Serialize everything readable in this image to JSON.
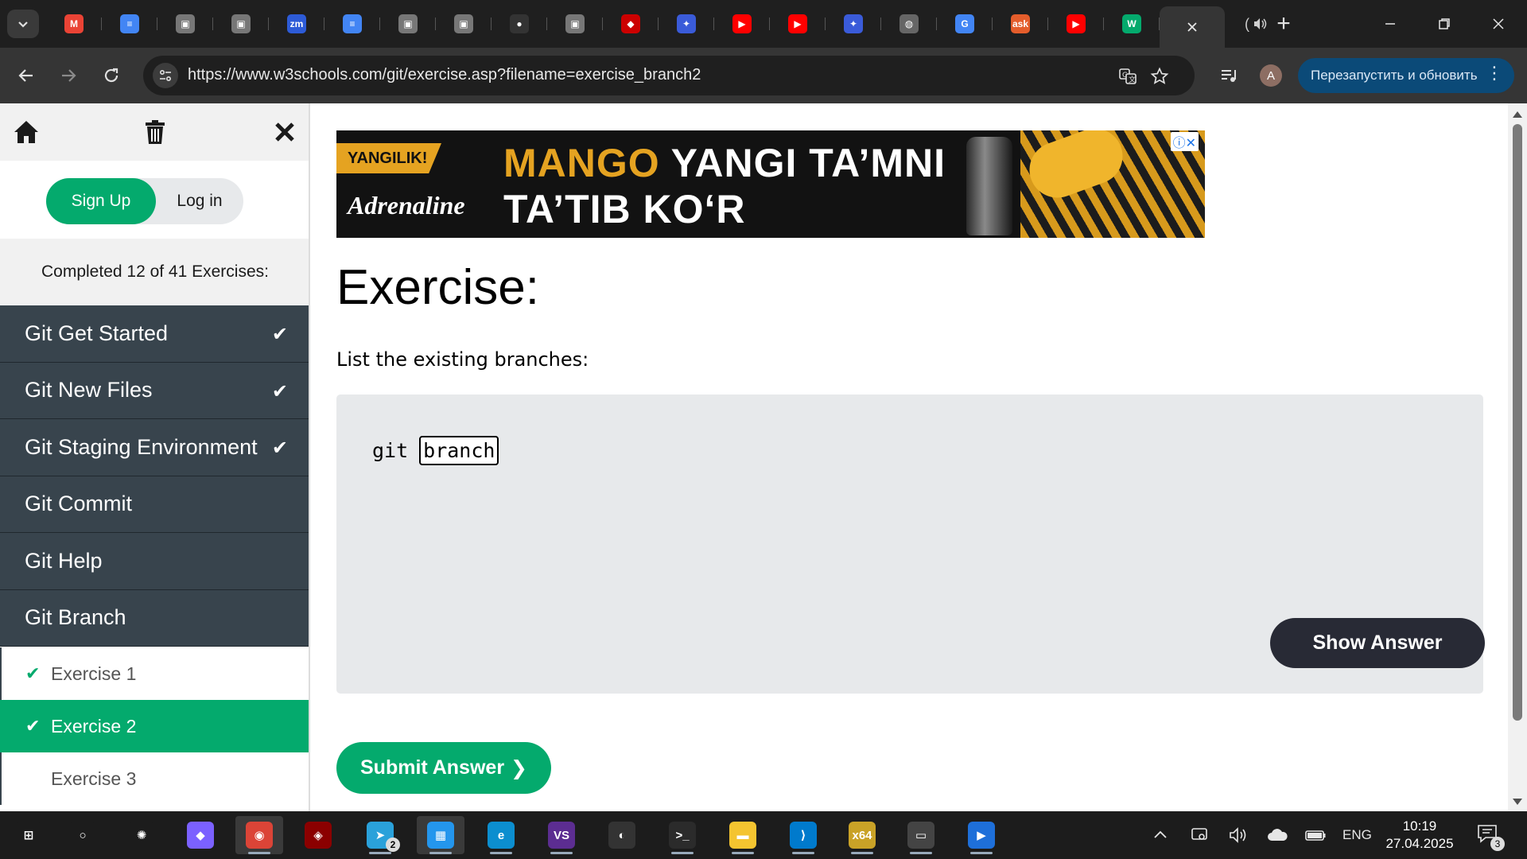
{
  "browser": {
    "tabs": [
      {
        "icon": "gmail-icon",
        "glyph": "M",
        "color": "#ea4335"
      },
      {
        "icon": "docs-icon",
        "glyph": "≡",
        "color": "#4285f4"
      },
      {
        "icon": "page-icon",
        "glyph": "▣",
        "color": "#777777"
      },
      {
        "icon": "page-icon",
        "glyph": "▣",
        "color": "#777777"
      },
      {
        "icon": "zoom-icon",
        "glyph": "zm",
        "color": "#2d5bd7"
      },
      {
        "icon": "docs-icon",
        "glyph": "≡",
        "color": "#4285f4"
      },
      {
        "icon": "page-icon",
        "glyph": "▣",
        "color": "#777777"
      },
      {
        "icon": "page-icon",
        "glyph": "▣",
        "color": "#777777"
      },
      {
        "icon": "github-icon",
        "glyph": "●",
        "color": "#333333"
      },
      {
        "icon": "page-icon",
        "glyph": "▣",
        "color": "#777777"
      },
      {
        "icon": "redhat-icon",
        "glyph": "◆",
        "color": "#cc0000"
      },
      {
        "icon": "bird-icon",
        "glyph": "✦",
        "color": "#3a5bd9"
      },
      {
        "icon": "youtube-icon",
        "glyph": "▶",
        "color": "#ff0000"
      },
      {
        "icon": "youtube-icon",
        "glyph": "▶",
        "color": "#ff0000"
      },
      {
        "icon": "bird-icon",
        "glyph": "✦",
        "color": "#3a5bd9"
      },
      {
        "icon": "globe-icon",
        "glyph": "◍",
        "color": "#666666"
      },
      {
        "icon": "translate-icon",
        "glyph": "G",
        "color": "#4285f4"
      },
      {
        "icon": "ask-icon",
        "glyph": "ask",
        "color": "#e45d2b"
      },
      {
        "icon": "youtube-icon",
        "glyph": "▶",
        "color": "#ff0000"
      },
      {
        "icon": "w3schools-icon",
        "glyph": "W",
        "color": "#04aa6d"
      }
    ],
    "audio_tab_label": "(",
    "url": "https://www.w3schools.com/git/exercise.asp?filename=exercise_branch2",
    "profile_initial": "A",
    "restart_label": "Перезапустить и обновить"
  },
  "sidebar": {
    "signup_label": "Sign Up",
    "login_label": "Log in",
    "progress_text": "Completed 12 of 41 Exercises:",
    "chapters": [
      {
        "label": "Git Get Started",
        "done": true
      },
      {
        "label": "Git New Files",
        "done": true
      },
      {
        "label": "Git Staging Environment",
        "done": true
      },
      {
        "label": "Git Commit",
        "done": false
      },
      {
        "label": "Git Help",
        "done": false
      },
      {
        "label": "Git Branch",
        "done": false
      }
    ],
    "exercises": [
      {
        "label": "Exercise 1",
        "done": true,
        "current": false
      },
      {
        "label": "Exercise 2",
        "done": true,
        "current": true
      },
      {
        "label": "Exercise 3",
        "done": false,
        "current": false
      }
    ]
  },
  "ad": {
    "badge": "YANGILIK!",
    "brand": "Adrenaline",
    "line1_highlight": "MANGO",
    "line1_rest": "YANGI TA’MNI",
    "line2": "TA’TIB KO‘R",
    "choices": "ⓘ✕"
  },
  "exercise": {
    "title": "Exercise:",
    "instruction": "List the existing branches:",
    "code_prefix": "git",
    "answer_value": "branch",
    "show_answer_label": "Show Answer",
    "submit_label": "Submit Answer",
    "submit_arrow": "❯"
  },
  "taskbar": {
    "apps": [
      {
        "name": "start-icon",
        "glyph": "⊞",
        "color": "#1c1c1c"
      },
      {
        "name": "search-icon",
        "glyph": "○",
        "color": "#1c1c1c"
      },
      {
        "name": "chatgpt-icon",
        "glyph": "✺",
        "color": "#1c1c1c"
      },
      {
        "name": "copilot-icon",
        "glyph": "◆",
        "color": "#7b61ff"
      },
      {
        "name": "chrome-icon",
        "glyph": "◉",
        "color": "#db4437"
      },
      {
        "name": "antivirus-icon",
        "glyph": "◈",
        "color": "#8b0000"
      },
      {
        "name": "telegram-icon",
        "glyph": "➤",
        "color": "#2aa1da"
      },
      {
        "name": "docker-icon",
        "glyph": "▦",
        "color": "#2496ed"
      },
      {
        "name": "edge-icon",
        "glyph": "e",
        "color": "#0c8ecf"
      },
      {
        "name": "visual-studio-icon",
        "glyph": "VS",
        "color": "#5c2d91"
      },
      {
        "name": "penguin-icon",
        "glyph": "◐",
        "color": "#333333"
      },
      {
        "name": "terminal-icon",
        "glyph": ">_",
        "color": "#2b2b2b"
      },
      {
        "name": "file-explorer-icon",
        "glyph": "▬",
        "color": "#f4c430"
      },
      {
        "name": "vscode-icon",
        "glyph": "⟩",
        "color": "#007acc"
      },
      {
        "name": "x64dbg-icon",
        "glyph": "x64",
        "color": "#c9a227"
      },
      {
        "name": "console-icon",
        "glyph": "▭",
        "color": "#444444"
      },
      {
        "name": "media-player-icon",
        "glyph": "▶",
        "color": "#1e6fd9"
      }
    ],
    "telegram_badge": "2",
    "language": "ENG",
    "time": "10:19",
    "date": "27.04.2025",
    "notifications_badge": "3"
  }
}
